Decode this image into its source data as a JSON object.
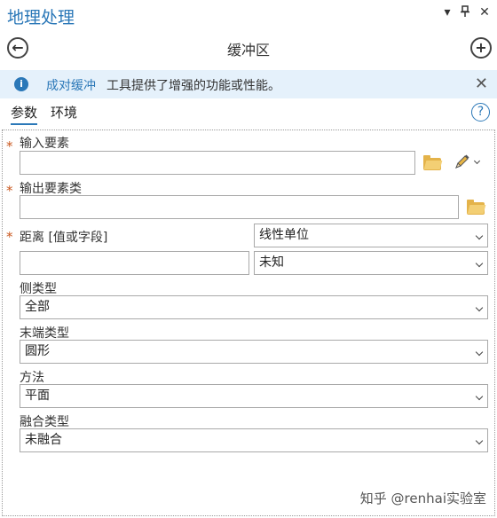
{
  "pane": {
    "title": "地理处理",
    "dropdown_glyph": "▾",
    "pin_glyph": "⊥",
    "close_glyph": "✕"
  },
  "nav": {
    "back_glyph": "←",
    "tool_title": "缓冲区",
    "add_glyph": "+"
  },
  "info": {
    "icon_glyph": "i",
    "link_text": "成对缓冲",
    "message": "工具提供了增强的功能或性能。",
    "close_glyph": "✕"
  },
  "tabs": {
    "params": "参数",
    "env": "环境",
    "help_glyph": "?"
  },
  "form": {
    "required_mark": "*",
    "input_features": {
      "label": "输入要素",
      "value": ""
    },
    "output_features": {
      "label": "输出要素类",
      "value": ""
    },
    "distance": {
      "label": "距离 [值或字段]",
      "type_value": "线性单位",
      "value": "",
      "unit_value": "未知"
    },
    "side_type": {
      "label": "侧类型",
      "value": "全部"
    },
    "end_type": {
      "label": "末端类型",
      "value": "圆形"
    },
    "method": {
      "label": "方法",
      "value": "平面"
    },
    "dissolve_type": {
      "label": "融合类型",
      "value": "未融合"
    }
  },
  "watermark": "知乎 @renhai实验室",
  "colors": {
    "accent": "#2b78b8",
    "info_bg": "#e5f1fb",
    "required": "#c9571e",
    "folder": "#e4b34a"
  }
}
